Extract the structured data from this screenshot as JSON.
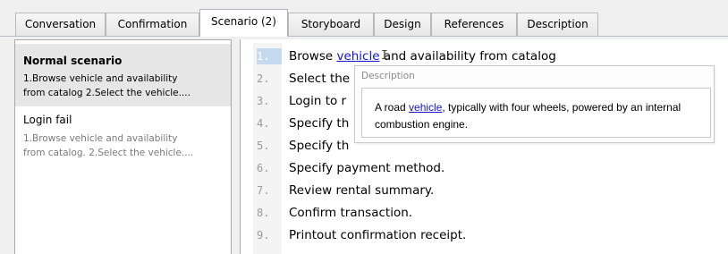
{
  "tabs": [
    {
      "label": "Conversation"
    },
    {
      "label": "Confirmation"
    },
    {
      "label": "Scenario (2)"
    },
    {
      "label": "Storyboard"
    },
    {
      "label": "Design"
    },
    {
      "label": "References"
    },
    {
      "label": "Description"
    }
  ],
  "active_tab": "Scenario (2)",
  "scenarios": [
    {
      "title": "Normal scenario",
      "desc_line1": "1.Browse vehicle and availability",
      "desc_line2": "from catalog 2.Select the vehicle...."
    },
    {
      "title": "Login fail",
      "desc_line1": "1.Browse vehicle and availability",
      "desc_line2": "from catalog. 2.Select the vehicle...."
    }
  ],
  "steps": [
    {
      "num": "1.",
      "pre": "Browse ",
      "link": "vehicle",
      "post": " and availability from catalog"
    },
    {
      "num": "2.",
      "text": "Select the"
    },
    {
      "num": "3.",
      "text": "Login to r"
    },
    {
      "num": "4.",
      "text": "Specify th"
    },
    {
      "num": "5.",
      "text": "Specify th"
    },
    {
      "num": "6.",
      "text": "Specify payment method."
    },
    {
      "num": "7.",
      "text": "Review rental summary."
    },
    {
      "num": "8.",
      "text": "Confirm transaction."
    },
    {
      "num": "9.",
      "text": "Printout confirmation receipt."
    }
  ],
  "tooltip": {
    "caption": "Description",
    "pre": "A road ",
    "link": "vehicle",
    "post": ", typically with four wheels, powered by an internal combustion engine."
  },
  "colors": {
    "accent": "#c5d9f1",
    "link": "#1616cc",
    "selected_row": "#e6e6e6"
  },
  "cursor": "I-beam"
}
